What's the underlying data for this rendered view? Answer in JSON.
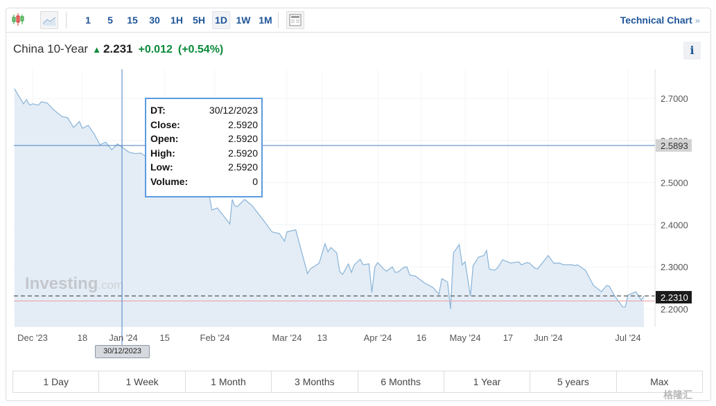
{
  "toolbar": {
    "chart_type_icons": [
      "candlestick-icon",
      "area-chart-icon"
    ],
    "intervals": [
      "1",
      "5",
      "15",
      "30",
      "1H",
      "5H",
      "1D",
      "1W",
      "1M"
    ],
    "active_interval": "1D",
    "layout_icon": "layout-icon",
    "technical_chart": "Technical Chart",
    "technical_chart_chevron": "»"
  },
  "instrument": {
    "name": "China 10-Year",
    "direction_icon": "arrow-up-icon",
    "last": "2.231",
    "change": "+0.012",
    "change_pct": "(+0.54%)",
    "info": "i"
  },
  "colors": {
    "accent": "#1e5598",
    "positive": "#0a8a3a",
    "line": "#8fb7d9",
    "fill": "#e4edf6",
    "crosshair": "#4a7fc0",
    "prev_close": "#e8a6ad"
  },
  "tooltip": {
    "rows": [
      {
        "k": "DT:",
        "v": "30/12/2023"
      },
      {
        "k": "Close:",
        "v": "2.5920"
      },
      {
        "k": "Open:",
        "v": "2.5920"
      },
      {
        "k": "High:",
        "v": "2.5920"
      },
      {
        "k": "Low:",
        "v": "2.5920"
      },
      {
        "k": "Volume:",
        "v": "0"
      }
    ]
  },
  "crosshair": {
    "date_label": "30/12/2023",
    "value_label": "2.5893"
  },
  "watermark": "Investing",
  "watermark_suffix": ".com",
  "chart_data": {
    "type": "area",
    "ylim": [
      2.15,
      2.76
    ],
    "y_ticks": [
      "2.7000",
      "2.6000",
      "2.5000",
      "2.4000",
      "2.3000",
      "2.2000"
    ],
    "x_ticks": [
      {
        "label": "Dec '23",
        "date": "2023-12-01"
      },
      {
        "label": "18",
        "date": "2023-12-18"
      },
      {
        "label": "Jan '24",
        "date": "2024-01-01"
      },
      {
        "label": "15",
        "date": "2024-01-15"
      },
      {
        "label": "Feb '24",
        "date": "2024-02-01"
      },
      {
        "label": "Mar '24",
        "date": "2024-03-01"
      },
      {
        "label": "13",
        "date": "2024-03-13"
      },
      {
        "label": "Apr '24",
        "date": "2024-04-01"
      },
      {
        "label": "16",
        "date": "2024-04-16"
      },
      {
        "label": "May '24",
        "date": "2024-05-01"
      },
      {
        "label": "17",
        "date": "2024-05-17"
      },
      {
        "label": "Jun '24",
        "date": "2024-06-01"
      },
      {
        "label": "Jul '24",
        "date": "2024-07-01"
      }
    ],
    "last_value": "2.2310",
    "last": 2.231,
    "previous_close": 2.219,
    "grid": true,
    "series": [
      [
        "2023-11-25",
        2.723
      ],
      [
        "2023-11-28",
        2.687
      ],
      [
        "2023-11-29",
        2.697
      ],
      [
        "2023-11-30",
        2.684
      ],
      [
        "2023-12-01",
        2.687
      ],
      [
        "2023-12-03",
        2.684
      ],
      [
        "2023-12-04",
        2.692
      ],
      [
        "2023-12-06",
        2.689
      ],
      [
        "2023-12-08",
        2.674
      ],
      [
        "2023-12-11",
        2.657
      ],
      [
        "2023-12-13",
        2.654
      ],
      [
        "2023-12-15",
        2.631
      ],
      [
        "2023-12-17",
        2.645
      ],
      [
        "2023-12-18",
        2.629
      ],
      [
        "2023-12-20",
        2.636
      ],
      [
        "2023-12-22",
        2.616
      ],
      [
        "2023-12-24",
        2.59
      ],
      [
        "2023-12-26",
        2.596
      ],
      [
        "2023-12-28",
        2.578
      ],
      [
        "2023-12-30",
        2.592
      ],
      [
        "2024-01-03",
        2.572
      ],
      [
        "2024-01-05",
        2.569
      ],
      [
        "2024-01-07",
        2.57
      ],
      [
        "2024-01-10",
        2.555
      ],
      [
        "2024-01-16",
        2.539
      ],
      [
        "2024-01-21",
        2.514
      ],
      [
        "2024-01-27",
        2.498
      ],
      [
        "2024-01-30",
        2.473
      ],
      [
        "2024-01-31",
        2.435
      ],
      [
        "2024-02-02",
        2.44
      ],
      [
        "2024-02-07",
        2.402
      ],
      [
        "2024-02-08",
        2.46
      ],
      [
        "2024-02-09",
        2.445
      ],
      [
        "2024-02-10",
        2.443
      ],
      [
        "2024-02-13",
        2.46
      ],
      [
        "2024-02-16",
        2.445
      ],
      [
        "2024-02-21",
        2.407
      ],
      [
        "2024-02-24",
        2.383
      ],
      [
        "2024-02-27",
        2.379
      ],
      [
        "2024-02-29",
        2.361
      ],
      [
        "2024-03-01",
        2.383
      ],
      [
        "2024-03-04",
        2.388
      ],
      [
        "2024-03-06",
        2.336
      ],
      [
        "2024-03-08",
        2.284
      ],
      [
        "2024-03-09",
        2.295
      ],
      [
        "2024-03-12",
        2.309
      ],
      [
        "2024-03-14",
        2.355
      ],
      [
        "2024-03-15",
        2.336
      ],
      [
        "2024-03-16",
        2.346
      ],
      [
        "2024-03-18",
        2.333
      ],
      [
        "2024-03-19",
        2.289
      ],
      [
        "2024-03-20",
        2.282
      ],
      [
        "2024-03-22",
        2.307
      ],
      [
        "2024-03-23",
        2.287
      ],
      [
        "2024-03-24",
        2.305
      ],
      [
        "2024-03-26",
        2.318
      ],
      [
        "2024-03-27",
        2.305
      ],
      [
        "2024-03-29",
        2.307
      ],
      [
        "2024-03-30",
        2.239
      ],
      [
        "2024-03-31",
        2.3
      ],
      [
        "2024-04-01",
        2.31
      ],
      [
        "2024-04-03",
        2.295
      ],
      [
        "2024-04-04",
        2.29
      ],
      [
        "2024-04-06",
        2.3
      ],
      [
        "2024-04-07",
        2.287
      ],
      [
        "2024-04-08",
        2.288
      ],
      [
        "2024-04-10",
        2.299
      ],
      [
        "2024-04-11",
        2.3
      ],
      [
        "2024-04-12",
        2.281
      ],
      [
        "2024-04-14",
        2.278
      ],
      [
        "2024-04-17",
        2.262
      ],
      [
        "2024-04-20",
        2.251
      ],
      [
        "2024-04-22",
        2.235
      ],
      [
        "2024-04-23",
        2.272
      ],
      [
        "2024-04-25",
        2.264
      ],
      [
        "2024-04-26",
        2.2
      ],
      [
        "2024-04-27",
        2.333
      ],
      [
        "2024-04-29",
        2.353
      ],
      [
        "2024-04-30",
        2.305
      ],
      [
        "2024-05-01",
        2.312
      ],
      [
        "2024-05-03",
        2.231
      ],
      [
        "2024-05-04",
        2.303
      ],
      [
        "2024-05-06",
        2.323
      ],
      [
        "2024-05-08",
        2.327
      ],
      [
        "2024-05-09",
        2.339
      ],
      [
        "2024-05-10",
        2.295
      ],
      [
        "2024-05-12",
        2.292
      ],
      [
        "2024-05-13",
        2.297
      ],
      [
        "2024-05-15",
        2.317
      ],
      [
        "2024-05-18",
        2.309
      ],
      [
        "2024-05-21",
        2.312
      ],
      [
        "2024-05-22",
        2.305
      ],
      [
        "2024-05-24",
        2.31
      ],
      [
        "2024-05-25",
        2.309
      ],
      [
        "2024-05-27",
        2.297
      ],
      [
        "2024-05-28",
        2.295
      ],
      [
        "2024-06-01",
        2.327
      ],
      [
        "2024-06-03",
        2.309
      ],
      [
        "2024-06-05",
        2.309
      ],
      [
        "2024-06-07",
        2.305
      ],
      [
        "2024-06-10",
        2.305
      ],
      [
        "2024-06-11",
        2.303
      ],
      [
        "2024-06-12",
        2.305
      ],
      [
        "2024-06-15",
        2.292
      ],
      [
        "2024-06-18",
        2.256
      ],
      [
        "2024-06-21",
        2.241
      ],
      [
        "2024-06-23",
        2.256
      ],
      [
        "2024-06-24",
        2.254
      ],
      [
        "2024-06-26",
        2.231
      ],
      [
        "2024-06-29",
        2.205
      ],
      [
        "2024-06-30",
        2.205
      ],
      [
        "2024-07-01",
        2.233
      ],
      [
        "2024-07-04",
        2.241
      ],
      [
        "2024-07-06",
        2.221
      ],
      [
        "2024-07-07",
        2.231
      ]
    ]
  },
  "ranges": [
    "1 Day",
    "1 Week",
    "1 Month",
    "3 Months",
    "6 Months",
    "1 Year",
    "5 years",
    "Max"
  ],
  "corner_watermark": "格隆汇"
}
